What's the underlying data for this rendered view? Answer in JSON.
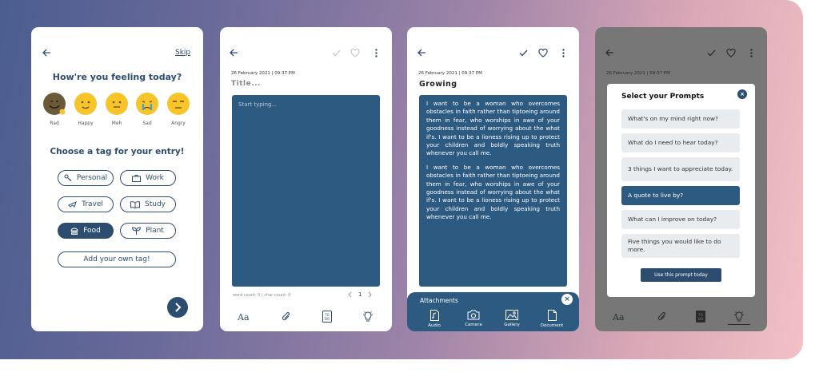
{
  "screen1": {
    "skip_label": "Skip",
    "question": "How're you feeling today?",
    "moods": [
      {
        "label": "Rad",
        "color": "#6b5a3a"
      },
      {
        "label": "Happy",
        "color": "#f7c52a"
      },
      {
        "label": "Meh",
        "color": "#f7c52a"
      },
      {
        "label": "Sad",
        "color": "#f7c52a"
      },
      {
        "label": "Angry",
        "color": "#f7c52a"
      }
    ],
    "tag_prompt": "Choose a tag for your entry!",
    "tags": [
      {
        "label": "Personal",
        "icon": "key-icon"
      },
      {
        "label": "Work",
        "icon": "briefcase-icon"
      },
      {
        "label": "Travel",
        "icon": "airplane-icon"
      },
      {
        "label": "Study",
        "icon": "book-icon"
      },
      {
        "label": "Food",
        "icon": "burger-icon"
      },
      {
        "label": "Plant",
        "icon": "sprout-icon"
      }
    ],
    "add_tag_label": "Add your own tag!"
  },
  "screen2": {
    "date": "26 February 2021 | 09:37 PM",
    "title_placeholder": "Title...",
    "body_placeholder": "Start typing...",
    "counts": "word count: 0 | char count: 0",
    "page": "1"
  },
  "screen3": {
    "date": "26 February 2021 | 09:37 PM",
    "title": "Growing",
    "paragraphs": [
      "I want to be a woman who overcomes obstacles in faith rather than tiptoeing around them in fear, who worships in awe of your goodness instead of worrying about the what if's. I want to be a lioness rising up to protect your children and boldly speaking truth whenever you call me.",
      "I want to be a woman who overcomes obstacles in faith rather than tiptoeing around them in fear, who worships in awe of your goodness instead of worrying about the what if's. I want to be a lioness rising up to protect your children and boldly speaking truth whenever you call me."
    ],
    "attachments_title": "Attachments",
    "attachments": [
      "Audio",
      "Camera",
      "Gallery",
      "Document"
    ]
  },
  "screen4": {
    "modal_title": "Select your Prompts",
    "prompts": [
      "What's on my mind right now?",
      "What do I need to hear today?",
      "3 things I want to appreciate today.",
      "A quote to live by?",
      "What can I improve on today?",
      "Five things you would like to do more."
    ],
    "selected_prompt_index": 3,
    "use_button": "Use this prompt today"
  },
  "colors": {
    "navy": "#2c4d70",
    "editor_blue": "#2c5a80"
  }
}
